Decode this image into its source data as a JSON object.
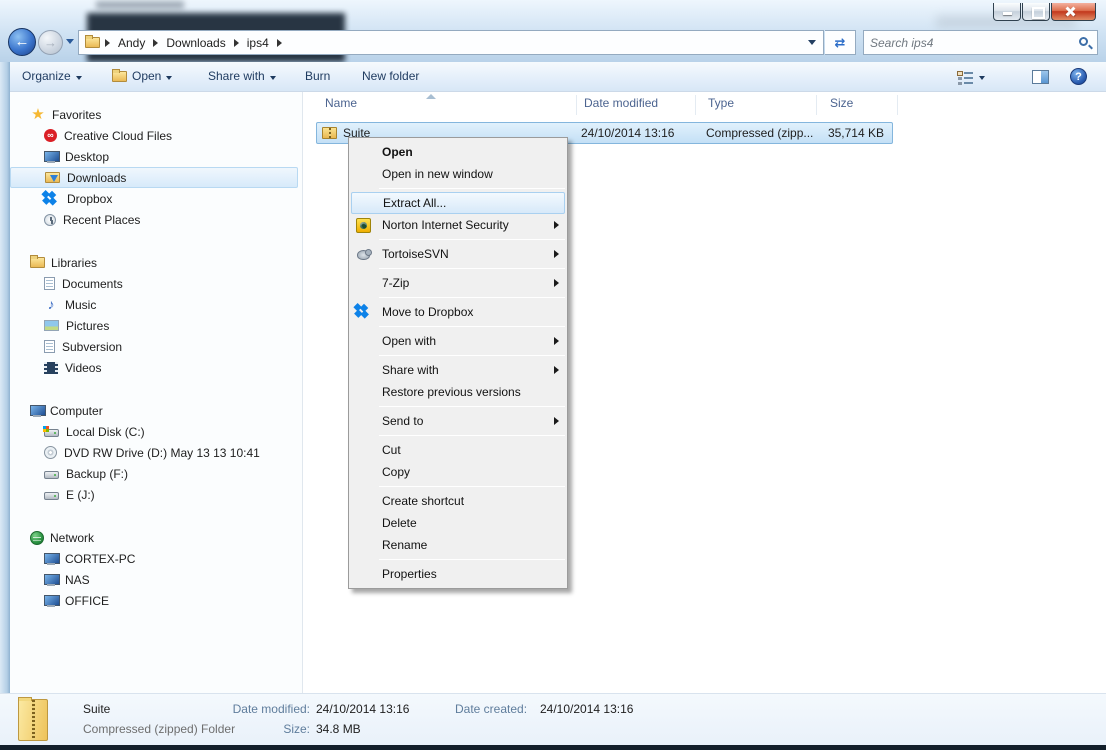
{
  "window": {
    "breadcrumb": [
      "Andy",
      "Downloads",
      "ips4"
    ],
    "search_placeholder": "Search ips4"
  },
  "toolbar": {
    "organize": "Organize",
    "open": "Open",
    "share_with": "Share with",
    "burn": "Burn",
    "new_folder": "New folder"
  },
  "columns": {
    "name": "Name",
    "date_modified": "Date modified",
    "type": "Type",
    "size": "Size"
  },
  "file": {
    "name": "Suite",
    "date_modified": "24/10/2014 13:16",
    "type": "Compressed (zipp...",
    "size": "35,714 KB"
  },
  "context_menu": {
    "items": [
      {
        "label": "Open"
      },
      {
        "label": "Open in new window"
      },
      {
        "label": "Extract All..."
      },
      {
        "label": "Norton Internet Security"
      },
      {
        "label": "TortoiseSVN"
      },
      {
        "label": "7-Zip"
      },
      {
        "label": "Move to Dropbox"
      },
      {
        "label": "Open with"
      },
      {
        "label": "Share with"
      },
      {
        "label": "Restore previous versions"
      },
      {
        "label": "Send to"
      },
      {
        "label": "Cut"
      },
      {
        "label": "Copy"
      },
      {
        "label": "Create shortcut"
      },
      {
        "label": "Delete"
      },
      {
        "label": "Rename"
      },
      {
        "label": "Properties"
      }
    ]
  },
  "sidebar": {
    "sections": [
      {
        "label": "Favorites",
        "items": [
          "Creative Cloud Files",
          "Desktop",
          "Downloads",
          "Dropbox",
          "Recent Places"
        ]
      },
      {
        "label": "Libraries",
        "items": [
          "Documents",
          "Music",
          "Pictures",
          "Subversion",
          "Videos"
        ]
      },
      {
        "label": "Computer",
        "items": [
          "Local Disk (C:)",
          "DVD RW Drive (D:) May 13 13 10:41",
          "Backup (F:)",
          "E (J:)"
        ]
      },
      {
        "label": "Network",
        "items": [
          "CORTEX-PC",
          "NAS",
          "OFFICE"
        ]
      }
    ]
  },
  "details": {
    "name": "Suite",
    "type": "Compressed (zipped) Folder",
    "date_modified_label": "Date modified:",
    "date_modified": "24/10/2014 13:16",
    "size_label": "Size:",
    "size": "34.8 MB",
    "date_created_label": "Date created:",
    "date_created": "24/10/2014 13:16"
  },
  "colors": {
    "selection_fill": "#c4e0f6",
    "selection_border": "#84b6dd",
    "close_button": "#c2371c",
    "folder_yellow": "#eaba55"
  }
}
